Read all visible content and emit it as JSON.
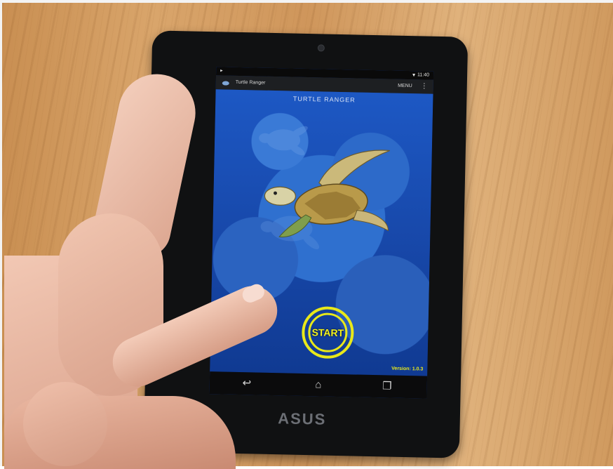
{
  "photo": {
    "device_brand": "ASUS"
  },
  "status_bar": {
    "time": "11:40",
    "wifi_icon": "wifi-icon",
    "signal_icon": "signal-icon"
  },
  "action_bar": {
    "app_name": "Turtle Ranger",
    "menu_label": "MENU",
    "overflow_icon": "overflow-menu-icon"
  },
  "app": {
    "title": "TURTLE RANGER",
    "start_label": "START",
    "version": "Version: 1.0.3"
  },
  "nav_bar": {
    "back_icon": "back-icon",
    "home_icon": "home-icon",
    "recents_icon": "recents-icon"
  },
  "colors": {
    "accent_yellow": "#e8e81a",
    "screen_blue": "#1d58c4",
    "wood": "#d9a56b"
  }
}
